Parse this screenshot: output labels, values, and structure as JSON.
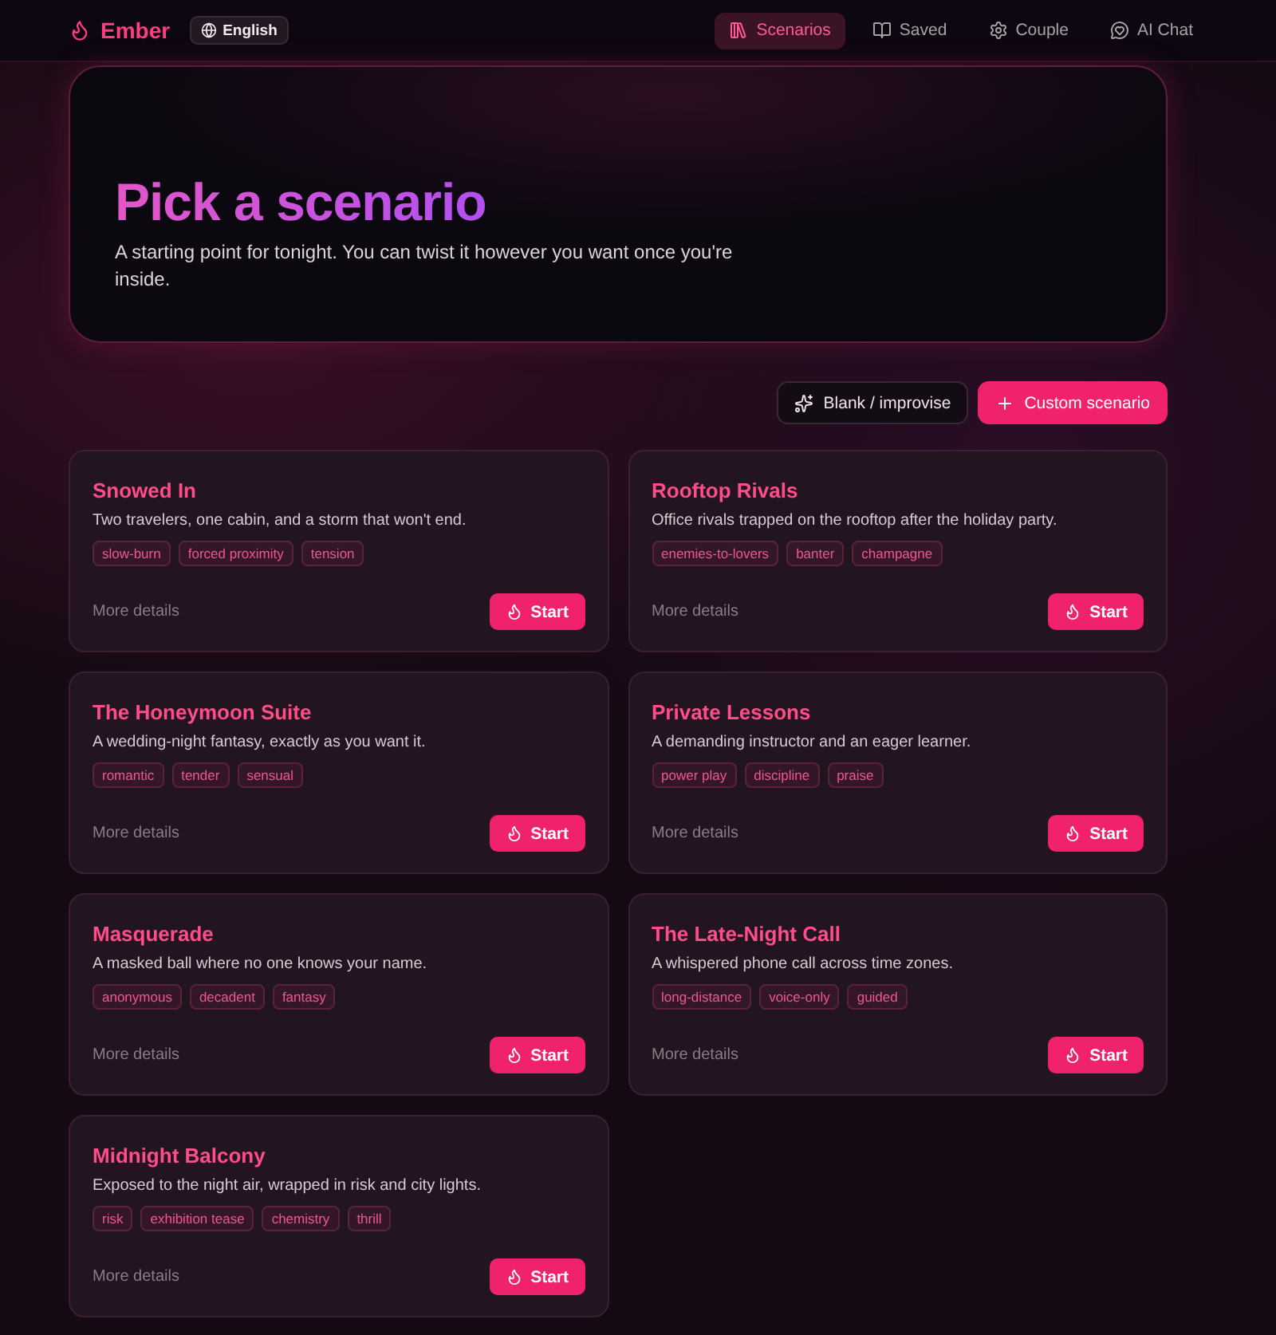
{
  "app": {
    "name": "Ember",
    "language": "English"
  },
  "nav": [
    {
      "label": "Scenarios",
      "selected": true
    },
    {
      "label": "Saved",
      "selected": false
    },
    {
      "label": "Couple",
      "selected": false
    },
    {
      "label": "AI Chat",
      "selected": false
    }
  ],
  "hero": {
    "title": "Pick a scenario",
    "subtitle": "A starting point for tonight. You can twist it however you want once you're inside."
  },
  "actions": [
    {
      "label": "Blank / improvise",
      "kind": "secondary"
    },
    {
      "label": "Custom scenario",
      "kind": "primary"
    }
  ],
  "scenarios": [
    {
      "title": "Snowed In",
      "description": "Two travelers, one cabin, and a storm that won't end.",
      "tags": [
        "slow-burn",
        "forced proximity",
        "tension"
      ],
      "details": "More details",
      "start": "Start"
    },
    {
      "title": "Rooftop Rivals",
      "description": "Office rivals trapped on the rooftop after the holiday party.",
      "tags": [
        "enemies-to-lovers",
        "banter",
        "champagne"
      ],
      "details": "More details",
      "start": "Start"
    },
    {
      "title": "The Honeymoon Suite",
      "description": "A wedding-night fantasy, exactly as you want it.",
      "tags": [
        "romantic",
        "tender",
        "sensual"
      ],
      "details": "More details",
      "start": "Start"
    },
    {
      "title": "Private Lessons",
      "description": "A demanding instructor and an eager learner.",
      "tags": [
        "power play",
        "discipline",
        "praise"
      ],
      "details": "More details",
      "start": "Start"
    },
    {
      "title": "Masquerade",
      "description": "A masked ball where no one knows your name.",
      "tags": [
        "anonymous",
        "decadent",
        "fantasy"
      ],
      "details": "More details",
      "start": "Start"
    },
    {
      "title": "The Late-Night Call",
      "description": "A whispered phone call across time zones.",
      "tags": [
        "long-distance",
        "voice-only",
        "guided"
      ],
      "details": "More details",
      "start": "Start"
    },
    {
      "title": "Midnight Balcony",
      "description": "Exposed to the night air, wrapped in risk and city lights.",
      "tags": [
        "risk",
        "exhibition tease",
        "chemistry",
        "thrill"
      ],
      "details": "More details",
      "start": "Start"
    }
  ]
}
